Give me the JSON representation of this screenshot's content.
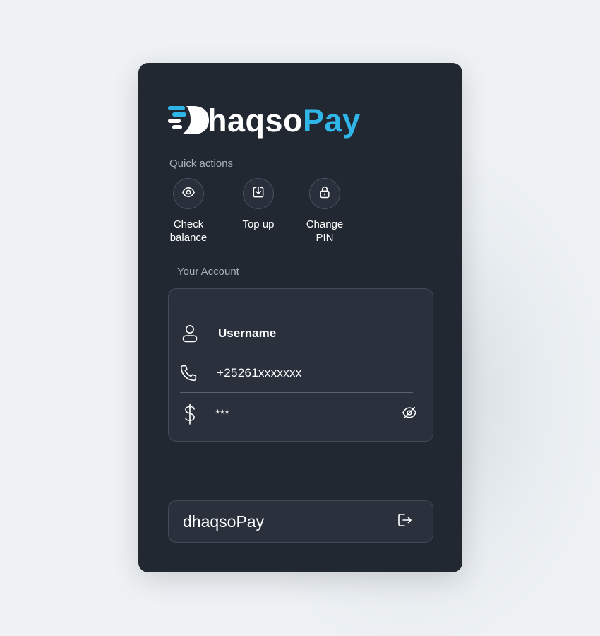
{
  "brand": {
    "name_part1": "Dhaqso",
    "name_part1_visible": "haqso",
    "name_part2": "Pay",
    "accent_color": "#2fb5e8",
    "logo_icon": "speed-d-logo-icon"
  },
  "quick_actions": {
    "label": "Quick actions",
    "items": [
      {
        "icon": "eye-icon",
        "label_line1": "Check",
        "label_line2": "balance"
      },
      {
        "icon": "download-tray-icon",
        "label_line1": "Top up",
        "label_line2": ""
      },
      {
        "icon": "lock-icon",
        "label_line1": "Change",
        "label_line2": "PIN"
      }
    ]
  },
  "account": {
    "label": "Your Account",
    "username": "Username",
    "phone": "+25261xxxxxxx",
    "balance_masked": "***",
    "icons": {
      "user": "user-icon",
      "phone": "phone-icon",
      "balance": "dollar-icon",
      "toggle": "eye-off-icon"
    }
  },
  "footer": {
    "brand_text": "dhaqsoPay",
    "logout_icon": "logout-icon"
  }
}
